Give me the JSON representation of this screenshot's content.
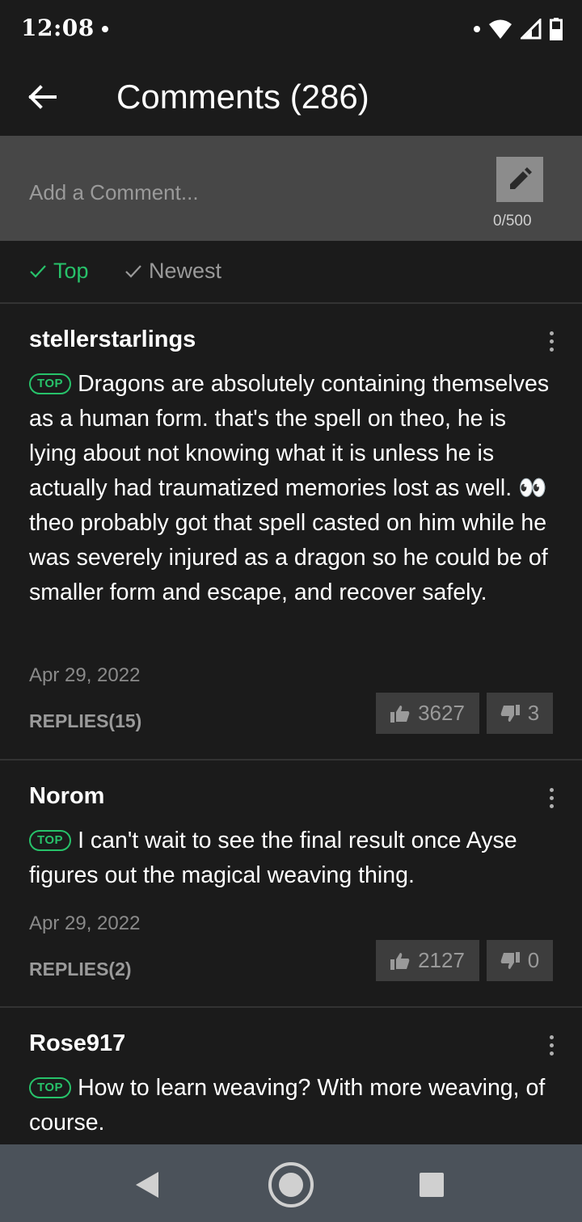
{
  "status_bar": {
    "time": "12:08"
  },
  "header": {
    "title": "Comments (286)"
  },
  "compose": {
    "placeholder": "Add a Comment...",
    "char_count": "0/500"
  },
  "sort": {
    "top_label": "Top",
    "newest_label": "Newest"
  },
  "badge_label": "TOP",
  "comments": [
    {
      "user": "stellerstarlings",
      "text_before": "Dragons are absolutely containing themselves as a human form. that's the spell on theo, he is lying about not knowing what it is unless he is actually had traumatized memories lost as well. ",
      "emoji": "👀",
      "text_after": " theo probably got that spell casted on him while he was severely injured as a dragon so he could be of smaller form and escape, and recover safely.",
      "date": "Apr 29, 2022",
      "replies": "REPLIES(15)",
      "likes": "3627",
      "dislikes": "3"
    },
    {
      "user": "Norom",
      "text_before": "I can't wait to see the final result once Ayse figures out the magical weaving thing.",
      "date": "Apr 29, 2022",
      "replies": "REPLIES(2)",
      "likes": "2127",
      "dislikes": "0"
    },
    {
      "user": "Rose917",
      "text_before": "How to learn weaving? With more weaving, of course."
    }
  ],
  "colors": {
    "accent": "#27c26a",
    "background": "#1b1b1b",
    "compose_bg": "#474747",
    "nav_bg": "#4b525a"
  }
}
